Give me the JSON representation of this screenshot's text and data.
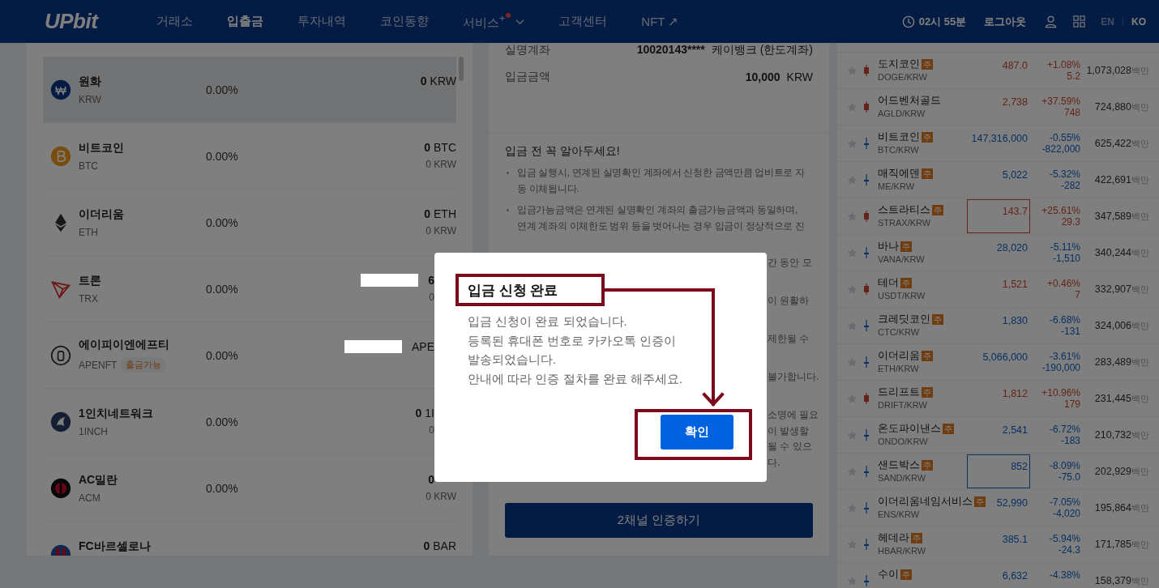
{
  "header": {
    "logo": "UPbit",
    "nav": [
      {
        "label": "거래소",
        "selected": false
      },
      {
        "label": "입출금",
        "selected": true
      },
      {
        "label": "투자내역",
        "selected": false
      },
      {
        "label": "코인동향",
        "selected": false
      },
      {
        "label": "서비스$^{+}$",
        "selected": false,
        "new": true,
        "dropdown": true
      },
      {
        "label": "고객센터",
        "selected": false
      },
      {
        "label": "NFT ↗",
        "selected": false
      }
    ],
    "timer": "02시 55분",
    "logout": "로그아웃",
    "languages": [
      {
        "label": "EN",
        "selected": false
      },
      {
        "label": "KO",
        "selected": true
      }
    ]
  },
  "holdings": {
    "rows": [
      {
        "name": "원화",
        "symbol": "KRW",
        "kind": "won",
        "share": "0.00%",
        "selected": true,
        "lines": [
          {
            "kind": "amount",
            "number": "0",
            "unit": "KRW"
          }
        ]
      },
      {
        "name": "비트코인",
        "symbol": "BTC",
        "kind": "bitcoin",
        "share": "0.00%",
        "selected": false,
        "lines": [
          {
            "kind": "amount",
            "number": "0",
            "unit": "BTC"
          },
          {
            "kind": "value",
            "text": "0 KRW"
          }
        ]
      },
      {
        "name": "이더리움",
        "symbol": "ETH",
        "kind": "ether",
        "share": "0.00%",
        "selected": false,
        "lines": [
          {
            "kind": "amount",
            "number": "0",
            "unit": "ETH"
          },
          {
            "kind": "value",
            "text": "0 KRW"
          }
        ]
      },
      {
        "name": "트론",
        "symbol": "TRX",
        "kind": "tron",
        "share": "0.00%",
        "selected": false,
        "lines": [
          {
            "kind": "redacted",
            "number": "6"
          },
          {
            "kind": "valueclip",
            "text": "0"
          }
        ]
      },
      {
        "name": "에이피이엔에프티",
        "symbol": "APENFT",
        "tag": "출금가능",
        "kind": "apenft",
        "share": "0.00%",
        "selected": false,
        "lines": [
          {
            "kind": "redacted",
            "unit": "APE"
          }
        ]
      },
      {
        "name": "1인치네트워크",
        "symbol": "1INCH",
        "kind": "oneinch",
        "share": "0.00%",
        "selected": false,
        "lines": [
          {
            "kind": "amountclip",
            "number": "0",
            "unit": "1I"
          },
          {
            "kind": "valueclip",
            "text": "0"
          }
        ]
      },
      {
        "name": "AC밀란",
        "symbol": "ACM",
        "kind": "milan",
        "share": "0.00%",
        "selected": false,
        "lines": [
          {
            "kind": "amountclip",
            "number": "0"
          },
          {
            "kind": "value",
            "text": "0 KRW"
          }
        ]
      },
      {
        "name": "FC바르셀로나",
        "kind": "barca",
        "selected": false,
        "lines": [
          {
            "kind": "amount",
            "number": "0",
            "unit": "BAR"
          }
        ]
      }
    ]
  },
  "deposit": {
    "rows": [
      {
        "label": "실명계좌",
        "number": "10020143****",
        "unit": "케이뱅크 (한도계좌)"
      },
      {
        "label": "입금금액",
        "number": "10,000",
        "unit": "KRW"
      }
    ],
    "notice_title": "입금 전 꼭 알아두세요!",
    "bullets": [
      {
        "lines": [
          "입금 실행시, 연계된 실명확인 계좌에서 신청한 금액만큼 업비트로 자",
          "동 이체됩니다."
        ]
      },
      {
        "lines": [
          "입금가능금액은 연계된 실명확인 계좌의 출금가능금액과 동일하며,",
          "연계 계좌의 이체한도 범위 등을 벗어나는 경우 입금이 정상적으로 진"
        ]
      }
    ],
    "covered_bullets": [
      {
        "lines": [
          "간 동안 모"
        ]
      },
      {
        "lines": [
          "이 원활하"
        ]
      },
      {
        "lines": [
          "제한될 수"
        ]
      },
      {
        "lines": [
          "불가합니다."
        ]
      },
      {
        "lines": [
          "소명에 필요",
          "이 발생할",
          "될 수 있으",
          "다."
        ]
      }
    ],
    "button": "2채널 인증하기"
  },
  "market": {
    "rows": [
      {
        "name": "도지코인",
        "badge": "주",
        "symbol": "DOGE/KRW",
        "price": "487.0",
        "pct": "+1.08%",
        "change": "5.2",
        "volume": "1,073,028",
        "unit": "백만",
        "rising": true,
        "highlight": false
      },
      {
        "name": "어드벤처골드",
        "symbol": "AGLD/KRW",
        "price": "2,738",
        "pct": "+37.59%",
        "change": "748",
        "volume": "724,880",
        "unit": "백만",
        "rising": true,
        "highlight": false
      },
      {
        "name": "비트코인",
        "badge": "주",
        "symbol": "BTC/KRW",
        "price": "147,316,000",
        "pct": "-0.55%",
        "change": "-822,000",
        "volume": "625,422",
        "unit": "백만",
        "rising": false,
        "highlight": false
      },
      {
        "name": "매직에덴",
        "badge": "주",
        "symbol": "ME/KRW",
        "price": "5,022",
        "pct": "-5.32%",
        "change": "-282",
        "volume": "422,691",
        "unit": "백만",
        "rising": false,
        "highlight": false
      },
      {
        "name": "스트라티스",
        "badge": "주",
        "symbol": "STRAX/KRW",
        "price": "143.7",
        "pct": "+25.61%",
        "change": "29.3",
        "volume": "347,589",
        "unit": "백만",
        "rising": true,
        "highlight": true
      },
      {
        "name": "바나",
        "badge": "주",
        "symbol": "VANA/KRW",
        "price": "28,020",
        "pct": "-5.11%",
        "change": "-1,510",
        "volume": "340,244",
        "unit": "백만",
        "rising": false,
        "highlight": false
      },
      {
        "name": "테더",
        "badge": "주",
        "symbol": "USDT/KRW",
        "price": "1,521",
        "pct": "+0.46%",
        "change": "7",
        "volume": "332,907",
        "unit": "백만",
        "rising": true,
        "highlight": false
      },
      {
        "name": "크레딧코인",
        "badge": "주",
        "symbol": "CTC/KRW",
        "price": "1,830",
        "pct": "-6.68%",
        "change": "-131",
        "volume": "324,006",
        "unit": "백만",
        "rising": false,
        "highlight": false
      },
      {
        "name": "이더리움",
        "badge": "주",
        "symbol": "ETH/KRW",
        "price": "5,066,000",
        "pct": "-3.61%",
        "change": "-190,000",
        "volume": "283,489",
        "unit": "백만",
        "rising": false,
        "highlight": false
      },
      {
        "name": "드리프트",
        "badge": "주",
        "symbol": "DRIFT/KRW",
        "price": "1,812",
        "pct": "+10.96%",
        "change": "179",
        "volume": "231,445",
        "unit": "백만",
        "rising": true,
        "highlight": false
      },
      {
        "name": "온도파이낸스",
        "badge": "주",
        "symbol": "ONDO/KRW",
        "price": "2,541",
        "pct": "-6.72%",
        "change": "-183",
        "volume": "210,732",
        "unit": "백만",
        "rising": false,
        "highlight": false
      },
      {
        "name": "샌드박스",
        "badge": "주",
        "symbol": "SAND/KRW",
        "price": "852",
        "pct": "-8.09%",
        "change": "-75.0",
        "volume": "202,929",
        "unit": "백만",
        "rising": false,
        "highlight": true
      },
      {
        "name": "이더리움네임서비스",
        "badge": "주",
        "symbol": "ENS/KRW",
        "price": "52,990",
        "pct": "-7.05%",
        "change": "-4,020",
        "volume": "195,864",
        "unit": "백만",
        "rising": false,
        "highlight": false
      },
      {
        "name": "헤데라",
        "badge": "주",
        "symbol": "HBAR/KRW",
        "price": "385.1",
        "pct": "-5.94%",
        "change": "-24.3",
        "volume": "171,785",
        "unit": "백만",
        "rising": false,
        "highlight": false
      },
      {
        "name": "수이",
        "badge": "주",
        "price": "6,632",
        "pct": "-4.38%",
        "volume": "158,379",
        "unit": "백만",
        "rising": false,
        "highlight": false
      }
    ]
  },
  "dialog": {
    "title": "입금 신청 완료",
    "lines": [
      "입금 신청이 완료 되었습니다.",
      "등록된 휴대폰 번호로 카카오톡 인증이",
      "발송되었습니다.",
      "안내에 따라 인증 절차를 완료 해주세요."
    ],
    "button": "확인"
  }
}
